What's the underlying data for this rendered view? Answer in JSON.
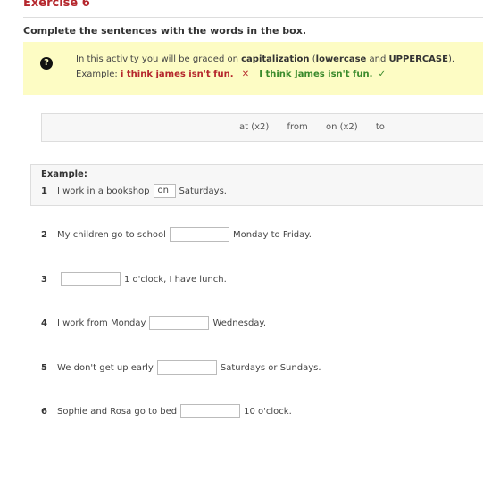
{
  "exercise": {
    "title": "Exercise 6",
    "instruction": "Complete the sentences with the words in the box."
  },
  "notice": {
    "icon": "question-circle-icon",
    "line1_prefix": "In this activity you will be graded on",
    "capitalization": "capitalization",
    "open_paren": "(",
    "lowercase": "lowercase",
    "and": "and",
    "uppercase": "UPPERCASE",
    "close_paren": ").",
    "example_label": "Example:",
    "wrong_i": "i",
    "wrong_think": "think",
    "wrong_james": "james",
    "wrong_rest": "isn't fun.",
    "cross": "✕",
    "correct": "I think James isn't fun.",
    "tick": "✓"
  },
  "word_box": [
    "at (x2)",
    "from",
    "on (x2)",
    "to"
  ],
  "example": {
    "label": "Example:",
    "number": "1",
    "before": "I work in a bookshop",
    "answer": "on",
    "after": "Saturdays."
  },
  "items": [
    {
      "number": "2",
      "before": "My children go to school",
      "value": "",
      "after": "Monday to Friday."
    },
    {
      "number": "3",
      "before": "",
      "value": "",
      "after": "1 o'clock, I have lunch."
    },
    {
      "number": "4",
      "before": "I work from Monday",
      "value": "",
      "after": "Wednesday."
    },
    {
      "number": "5",
      "before": "We don't get up early",
      "value": "",
      "after": "Saturdays or Sundays."
    },
    {
      "number": "6",
      "before": "Sophie and Rosa go to bed",
      "value": "",
      "after": "10 o'clock."
    }
  ]
}
